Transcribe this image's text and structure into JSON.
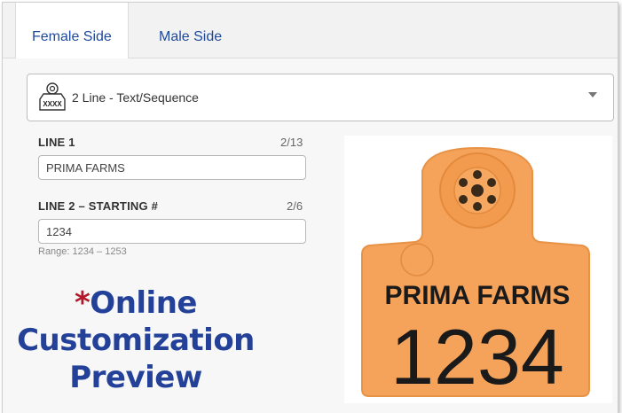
{
  "tabs": [
    {
      "label": "Female Side",
      "active": true
    },
    {
      "label": "Male Side",
      "active": false
    }
  ],
  "tag_select": {
    "icon": "ear-tag-icon",
    "icon_text": "XXXX",
    "selected": "2 Line - Text/Sequence"
  },
  "line1": {
    "label": "LINE 1",
    "count": "2/13",
    "value": "PRIMA FARMS"
  },
  "line2": {
    "label": "LINE 2 – STARTING #",
    "count": "2/6",
    "value": "1234",
    "range": "Range: 1234 – 1253"
  },
  "promo": {
    "star": "*",
    "line1": "Online",
    "line2": "Customization",
    "line3": "Preview"
  },
  "preview": {
    "line1": "PRIMA FARMS",
    "line2": "1234",
    "tag_color": "#f5a35a"
  },
  "colors": {
    "accent": "#1f4a9a",
    "promo_blue": "#24419a",
    "promo_star": "#b3182b"
  }
}
